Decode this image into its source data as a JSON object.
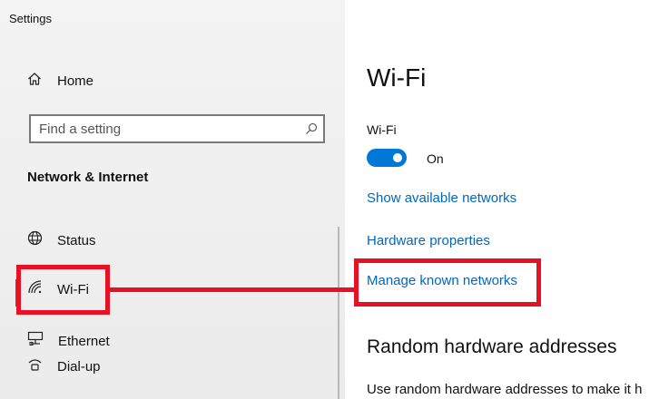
{
  "window": {
    "title": "Settings"
  },
  "sidebar": {
    "home_label": "Home",
    "search_placeholder": "Find a setting",
    "section": "Network & Internet",
    "items": [
      {
        "label": "Status",
        "icon": "globe-icon"
      },
      {
        "label": "Wi-Fi",
        "icon": "wifi-icon",
        "selected": true
      },
      {
        "label": "Ethernet",
        "icon": "ethernet-icon"
      },
      {
        "label": "Dial-up",
        "icon": "dialup-icon"
      }
    ]
  },
  "main": {
    "title": "Wi-Fi",
    "wifi_toggle": {
      "label": "Wi-Fi",
      "state": "On",
      "on": true
    },
    "links": {
      "show_networks": "Show available networks",
      "hardware_properties": "Hardware properties",
      "manage_known": "Manage known networks"
    },
    "random_hw": {
      "heading": "Random hardware addresses",
      "description": "Use random hardware addresses to make it h"
    }
  },
  "colors": {
    "accent": "#0078d7",
    "link": "#0067c0",
    "highlight": "#e81123",
    "sidebar_bg": "#f0f0f0"
  }
}
